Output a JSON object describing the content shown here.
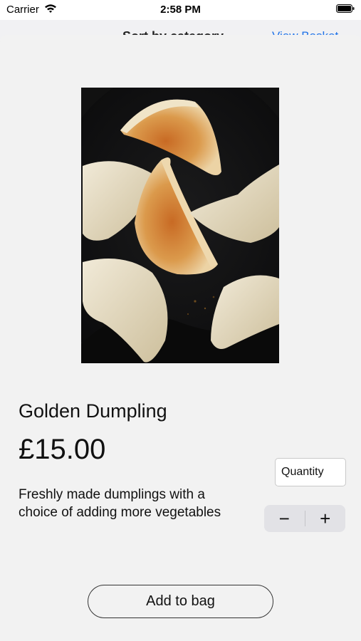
{
  "status_bar": {
    "carrier": "Carrier",
    "time": "2:58 PM"
  },
  "background_screen": {
    "title": "Sort by category",
    "link": "View Basket"
  },
  "product": {
    "name": "Golden Dumpling",
    "price": "£15.00",
    "description": "Freshly made dumplings with a choice of adding more vegetables"
  },
  "quantity": {
    "placeholder": "Quantity"
  },
  "stepper": {
    "decrement_label": "−",
    "increment_label": "+"
  },
  "add_to_bag": {
    "label": "Add to bag"
  }
}
